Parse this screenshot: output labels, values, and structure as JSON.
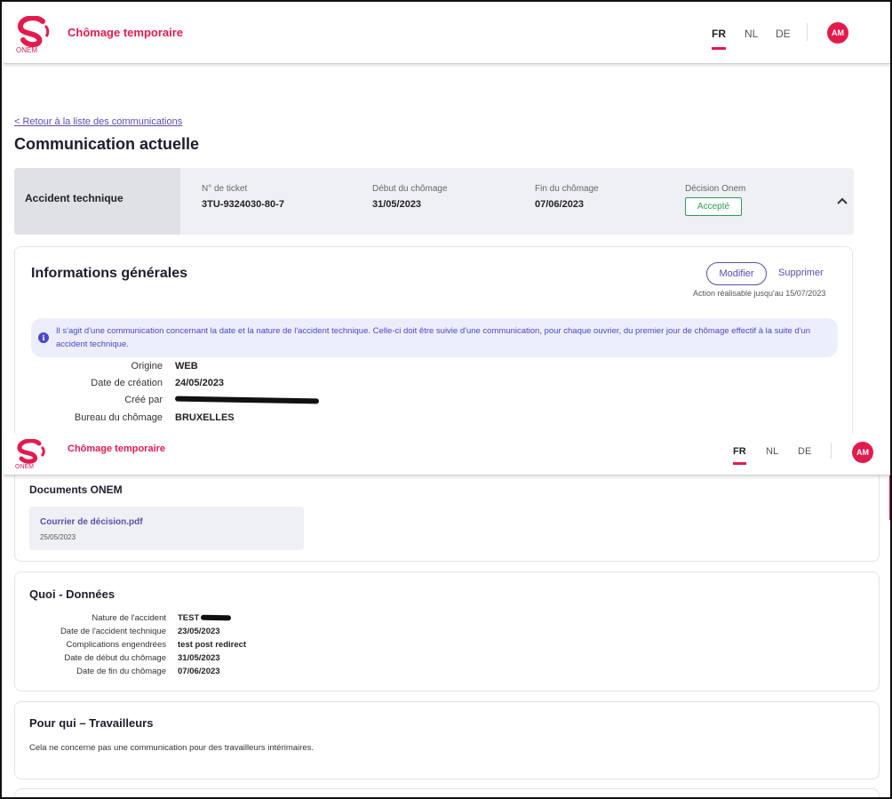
{
  "header": {
    "app_title": "Chômage temporaire",
    "logo_text": "ONEM",
    "languages": [
      "FR",
      "NL",
      "DE"
    ],
    "active_language": "FR",
    "avatar_initials": "AM"
  },
  "nav": {
    "back_link": "< Retour à la liste des communications"
  },
  "page_title": "Communication actuelle",
  "summary": {
    "type": "Accident technique",
    "ticket_label": "N° de ticket",
    "ticket_value": "3TU-9324030-80-7",
    "start_label": "Début du chômage",
    "start_value": "31/05/2023",
    "end_label": "Fin du chômage",
    "end_value": "07/06/2023",
    "decision_label": "Décision Onem",
    "decision_value": "Accepté"
  },
  "general_info": {
    "title": "Informations générales",
    "modify_label": "Modifier",
    "delete_label": "Supprimer",
    "action_note": "Action réalisable jusqu'au 15/07/2023",
    "info_text": "Il s'agit d'une communication concernant la date et la nature de l'accident technique. Celle-ci doit être suivie d'une communication, pour chaque ouvrier, du premier jour de chômage effectif à la suite d'un accident technique.",
    "fields": [
      {
        "label": "Origine",
        "value": "WEB"
      },
      {
        "label": "Date de création",
        "value": "24/05/2023"
      },
      {
        "label": "Créé par",
        "value": ""
      },
      {
        "label": "Bureau du chômage",
        "value": "BRUXELLES"
      }
    ]
  },
  "documents": {
    "title": "Documents ONEM",
    "items": [
      {
        "name": "Courrier de décision.pdf",
        "date": "25/05/2023"
      }
    ]
  },
  "quoi": {
    "title": "Quoi - Données",
    "fields": [
      {
        "label": "Nature de l'accident",
        "value": "TEST"
      },
      {
        "label": "Date de l'accident technique",
        "value": "23/05/2023"
      },
      {
        "label": "Complications engendrées",
        "value": "test post redirect"
      },
      {
        "label": "Date de début du chômage",
        "value": "31/05/2023"
      },
      {
        "label": "Date de fin du chômage",
        "value": "07/06/2023"
      }
    ]
  },
  "pour_qui": {
    "title": "Pour qui – Travailleurs",
    "text": "Cela ne concerne pas une communication pour des travailleurs intérimaires."
  },
  "colors": {
    "brand_red": "#e21b4d",
    "accent_purple": "#5a4db0",
    "success_green": "#2e9a57",
    "info_blue": "#4a47c9"
  },
  "icons": [
    "onem-logo",
    "chevron-up-icon",
    "info-icon"
  ]
}
